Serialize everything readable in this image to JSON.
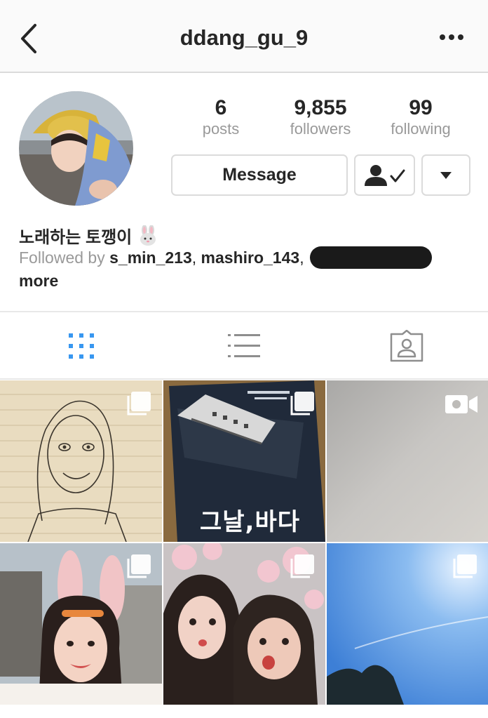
{
  "header": {
    "username": "ddang_gu_9",
    "back_icon": "chevron-left-icon",
    "more_icon": "more-horizontal-icon"
  },
  "stats": {
    "posts": {
      "value": "6",
      "label": "posts"
    },
    "followers": {
      "value": "9,855",
      "label": "followers"
    },
    "following": {
      "value": "99",
      "label": "following"
    }
  },
  "actions": {
    "message_label": "Message",
    "following_icon": "person-check-icon",
    "dropdown_icon": "caret-down-icon"
  },
  "bio": {
    "name": "노래하는 토깽이",
    "name_emoji": "rabbit-face-icon",
    "followed_by_prefix": "Followed by ",
    "followed_user_1": "s_min_213",
    "separator_1": ", ",
    "followed_user_2": "mashiro_143",
    "separator_2": ",",
    "more": "more"
  },
  "tabs": [
    {
      "icon": "grid-icon",
      "active": true
    },
    {
      "icon": "list-icon",
      "active": false
    },
    {
      "icon": "tagged-photos-icon",
      "active": false
    }
  ],
  "posts": [
    {
      "type": "carousel",
      "description_icon": "multiple-photos-icon"
    },
    {
      "type": "carousel",
      "description_icon": "multiple-photos-icon",
      "poster_text": "그날,바다"
    },
    {
      "type": "video",
      "description_icon": "video-camera-icon"
    },
    {
      "type": "carousel",
      "description_icon": "multiple-photos-icon"
    },
    {
      "type": "carousel",
      "description_icon": "multiple-photos-icon"
    },
    {
      "type": "carousel",
      "description_icon": "multiple-photos-icon"
    }
  ],
  "colors": {
    "active_tab": "#3897f0",
    "inactive_icon": "#8e8e8e",
    "border": "#dbdbdb",
    "muted_text": "#999999"
  }
}
